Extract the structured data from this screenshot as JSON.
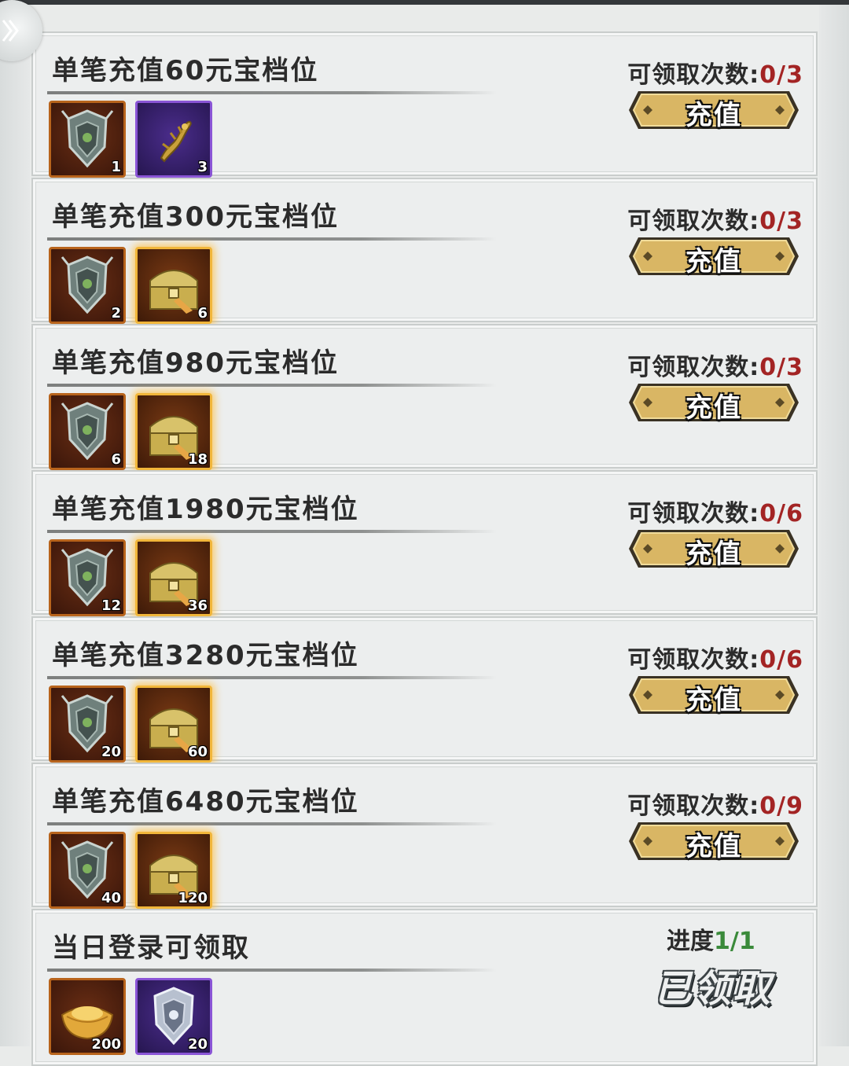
{
  "colors": {
    "count_value": "#a32424",
    "progress_value": "#3a8a3a",
    "button_gold": "#d9b664",
    "orange_frame": "#b8641c",
    "purple_frame": "#8a55d6",
    "gold_glow_frame": "#f1b63a"
  },
  "nav": {
    "back_icon": "double-chevron-right-icon"
  },
  "tiers": [
    {
      "title": "单笔充值60元宝档位",
      "count_label": "可领取次数:",
      "count_value": "0/3",
      "button_label": "充值",
      "items": [
        {
          "icon": "token-shield-icon",
          "frame": "orange",
          "qty": "1"
        },
        {
          "icon": "dragon-fragment-icon",
          "frame": "purple",
          "qty": "3"
        }
      ]
    },
    {
      "title": "单笔充值300元宝档位",
      "count_label": "可领取次数:",
      "count_value": "0/3",
      "button_label": "充值",
      "items": [
        {
          "icon": "token-shield-icon",
          "frame": "orange",
          "qty": "2"
        },
        {
          "icon": "treasure-chest-icon",
          "frame": "gold",
          "qty": "6"
        }
      ]
    },
    {
      "title": "单笔充值980元宝档位",
      "count_label": "可领取次数:",
      "count_value": "0/3",
      "button_label": "充值",
      "items": [
        {
          "icon": "token-shield-icon",
          "frame": "orange",
          "qty": "6"
        },
        {
          "icon": "treasure-chest-icon",
          "frame": "gold",
          "qty": "18"
        }
      ]
    },
    {
      "title": "单笔充值1980元宝档位",
      "count_label": "可领取次数:",
      "count_value": "0/6",
      "button_label": "充值",
      "items": [
        {
          "icon": "token-shield-icon",
          "frame": "orange",
          "qty": "12"
        },
        {
          "icon": "treasure-chest-icon",
          "frame": "gold",
          "qty": "36"
        }
      ]
    },
    {
      "title": "单笔充值3280元宝档位",
      "count_label": "可领取次数:",
      "count_value": "0/6",
      "button_label": "充值",
      "items": [
        {
          "icon": "token-shield-icon",
          "frame": "orange",
          "qty": "20"
        },
        {
          "icon": "treasure-chest-icon",
          "frame": "gold",
          "qty": "60"
        }
      ]
    },
    {
      "title": "单笔充值6480元宝档位",
      "count_label": "可领取次数:",
      "count_value": "0/9",
      "button_label": "充值",
      "items": [
        {
          "icon": "token-shield-icon",
          "frame": "orange",
          "qty": "40"
        },
        {
          "icon": "treasure-chest-icon",
          "frame": "gold",
          "qty": "120"
        }
      ]
    }
  ],
  "daily": {
    "title": "当日登录可领取",
    "progress_label": "进度",
    "progress_value": "1/1",
    "status": "已领取",
    "items": [
      {
        "icon": "gold-ingot-icon",
        "frame": "orange",
        "qty": "200"
      },
      {
        "icon": "silver-token-shield-icon",
        "frame": "purple",
        "qty": "20"
      }
    ]
  }
}
